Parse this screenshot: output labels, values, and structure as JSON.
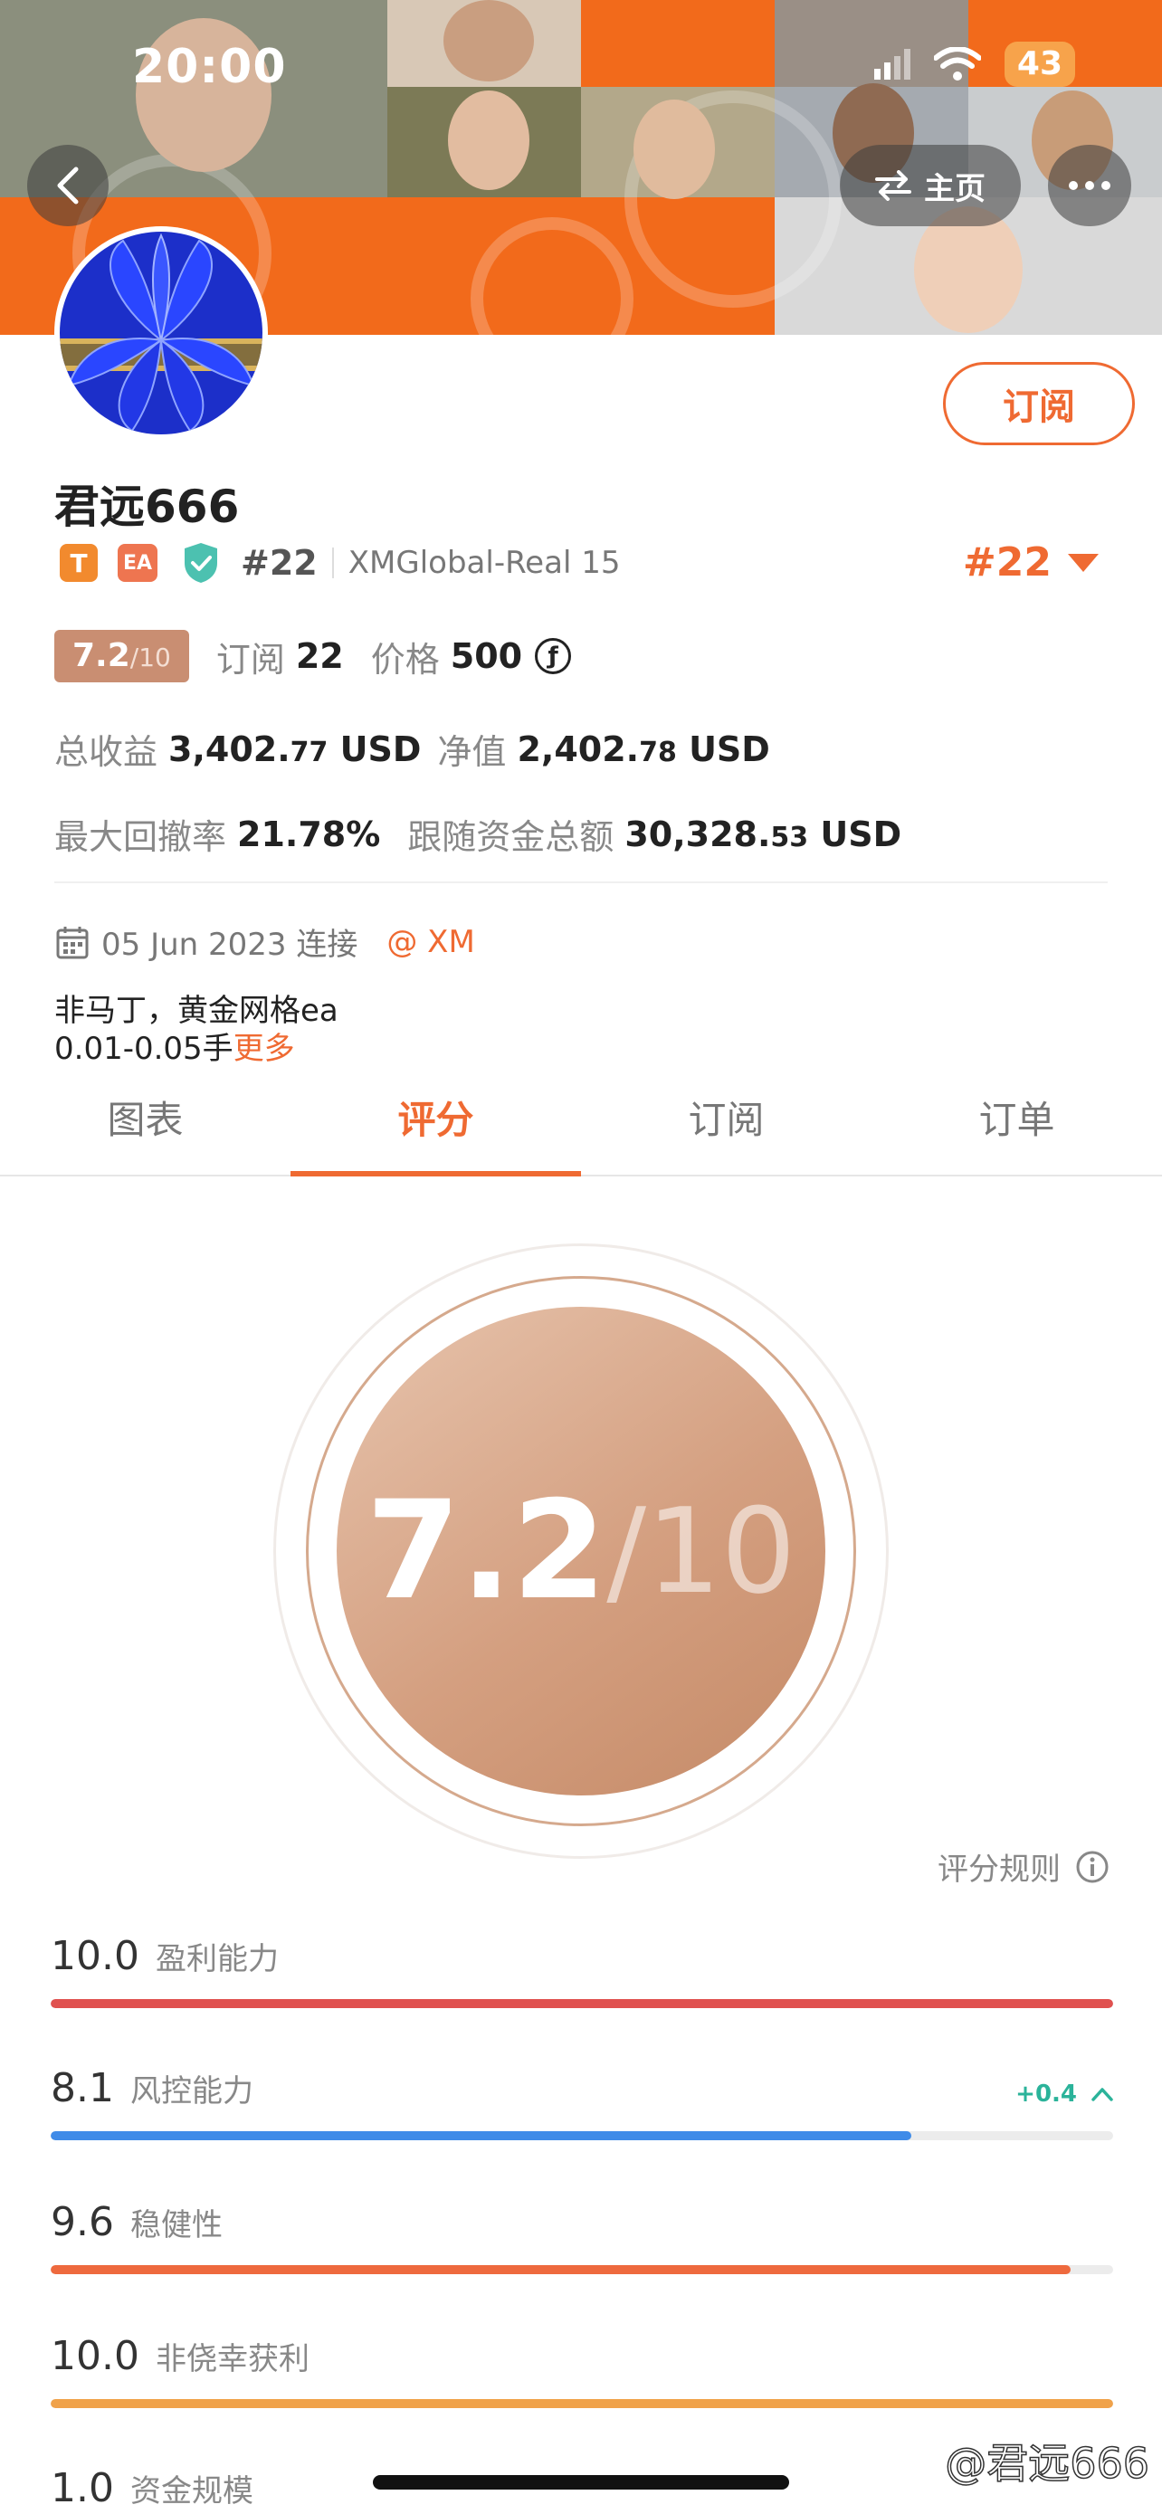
{
  "status_bar": {
    "time": "20:00",
    "battery": "43"
  },
  "nav": {
    "home_label": "主页"
  },
  "profile": {
    "name": "君远666",
    "subscribe_label": "订阅",
    "badge_t": "T",
    "badge_ea": "EA",
    "rank": "#22",
    "server": "XMGlobal-Real 15",
    "rank_right": "#22"
  },
  "stats": {
    "score_main": "7.2",
    "score_max": "/10",
    "subscribe_label": "订阅",
    "subscribe_count": "22",
    "price_label": "价格",
    "price_value": "500",
    "price_currency_icon": "ƒ",
    "total_profit_label": "总收益",
    "total_profit_int": "3,402.",
    "total_profit_dec": "77",
    "total_profit_unit": "USD",
    "net_label": "净值",
    "net_int": "2,402.",
    "net_dec": "78",
    "net_unit": "USD",
    "drawdown_label": "最大回撤率",
    "drawdown_value": "21.78%",
    "follow_label": "跟随资金总额",
    "follow_int": "30,328.",
    "follow_dec": "53",
    "follow_unit": "USD"
  },
  "connection": {
    "date": "05 Jun 2023 连接",
    "broker": "@ XM"
  },
  "description": {
    "line1": "非马丁，黄金网格ea",
    "line2": "0.01-0.05手",
    "more": "更多"
  },
  "tabs": [
    {
      "label": "图表"
    },
    {
      "label": "评分"
    },
    {
      "label": "订阅"
    },
    {
      "label": "订单"
    }
  ],
  "score_circle": {
    "value": "7.2",
    "max": "/10"
  },
  "rules_label": "评分规则",
  "metrics": [
    {
      "value": "10.0",
      "name": "盈利能力",
      "fill": 1.0,
      "color": "#e0514f",
      "change": ""
    },
    {
      "value": "8.1",
      "name": "风控能力",
      "fill": 0.81,
      "color": "#3f8be8",
      "change": "+0.4"
    },
    {
      "value": "9.6",
      "name": "稳健性",
      "fill": 0.96,
      "color": "#ee6a3e",
      "change": ""
    },
    {
      "value": "10.0",
      "name": "非侥幸获利",
      "fill": 1.0,
      "color": "#f0a24a",
      "change": ""
    },
    {
      "value": "1.0",
      "name": "资金规模",
      "fill": 0.1,
      "color": "#e0514f",
      "change": ""
    }
  ],
  "watermark": "@君远666"
}
